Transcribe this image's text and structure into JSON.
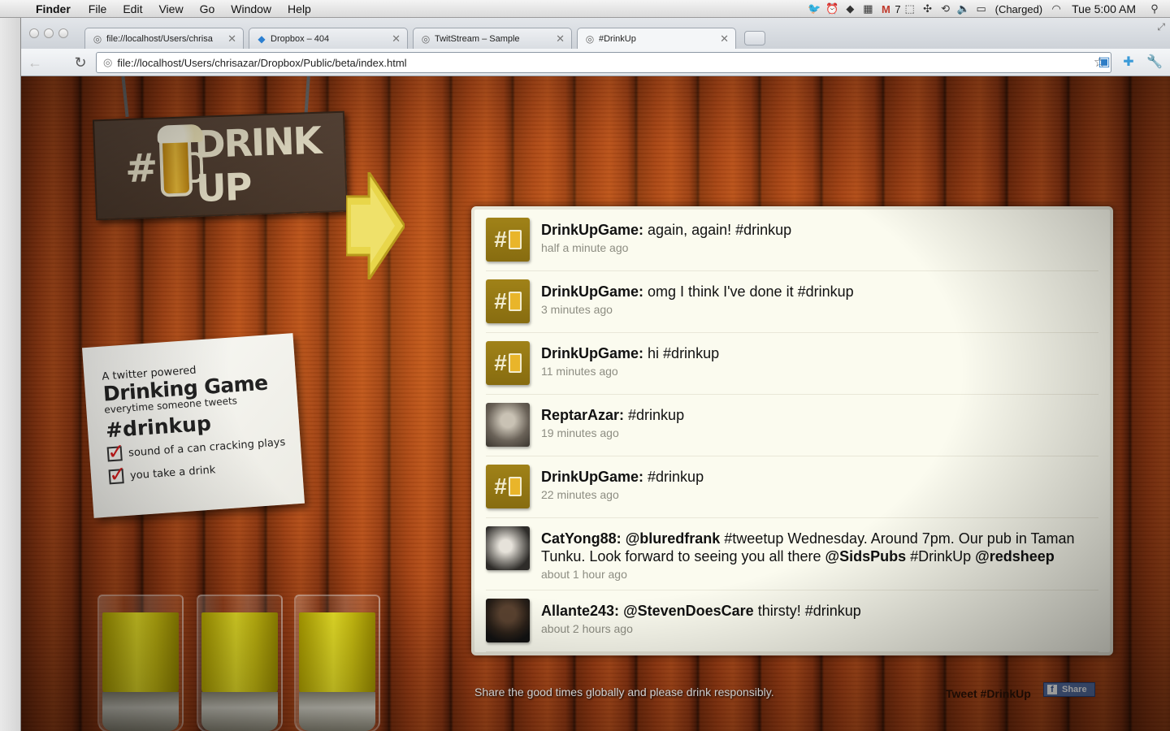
{
  "menubar": {
    "app": "Finder",
    "menus": [
      "File",
      "Edit",
      "View",
      "Go",
      "Window",
      "Help"
    ],
    "gmail_count": "7",
    "battery": "(Charged)",
    "clock": "Tue 5:00 AM"
  },
  "tabs": [
    {
      "title": "file://localhost/Users/chrisa",
      "icon": "globe-icon"
    },
    {
      "title": "Dropbox – 404",
      "icon": "dropbox-icon"
    },
    {
      "title": "TwitStream – Sample",
      "icon": "globe-icon"
    },
    {
      "title": "#DrinkUp",
      "icon": "globe-icon"
    }
  ],
  "toolbar": {
    "url": "file://localhost/Users/chrisazar/Dropbox/Public/beta/index.html"
  },
  "sign": {
    "hash": "#",
    "word": "DRINK UP"
  },
  "napkin": {
    "line1": "A twitter powered",
    "line2": "Drinking Game",
    "line3": "everytime someone tweets",
    "line4": "#drinkup",
    "check1": "sound of a can cracking plays",
    "check2": "you take a drink"
  },
  "tweets": [
    {
      "user": "DrinkUpGame:",
      "text": " again, again! #drinkup",
      "time": "half a minute ago",
      "avatar": "game"
    },
    {
      "user": "DrinkUpGame:",
      "text": " omg I think I've done it #drinkup",
      "time": "3 minutes ago",
      "avatar": "game"
    },
    {
      "user": "DrinkUpGame:",
      "text": " hi #drinkup",
      "time": "11 minutes ago",
      "avatar": "game"
    },
    {
      "user": "ReptarAzar:",
      "text": " #drinkup",
      "time": "19 minutes ago",
      "avatar": "photo"
    },
    {
      "user": "DrinkUpGame:",
      "text": " #drinkup",
      "time": "22 minutes ago",
      "avatar": "game"
    },
    {
      "user": "CatYong88:",
      "text_parts": [
        " ",
        "@bluredfrank",
        " #tweetup Wednesday. Around 7pm. Our pub in Taman Tunku. Look forward to seeing you all there ",
        "@SidsPubs",
        " #DrinkUp ",
        "@redsheep"
      ],
      "time": "about 1 hour ago",
      "avatar": "photo"
    },
    {
      "user": "Allante243:",
      "text_parts": [
        " ",
        "@StevenDoesCare",
        " thirsty! #drinkup"
      ],
      "time": "about 2 hours ago",
      "avatar": "photo"
    }
  ],
  "footer": {
    "note": "Share the good times globally and please drink responsibly.",
    "tweet_link": "Tweet #DrinkUp",
    "share_label": "Share"
  }
}
